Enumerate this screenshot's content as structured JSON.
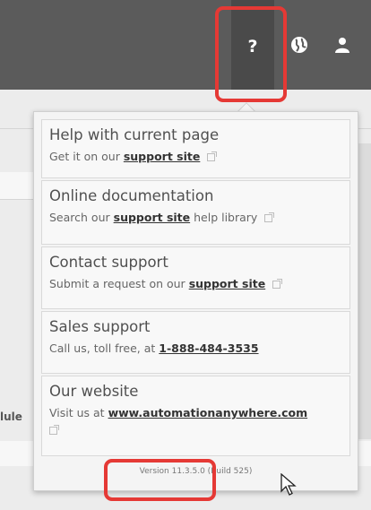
{
  "topbar": {
    "help_label": "?",
    "icons": {
      "globe": "globe-icon",
      "user": "user-icon"
    }
  },
  "background": {
    "left_text": "lule"
  },
  "help_menu": {
    "items": [
      {
        "title": "Help with current page",
        "sub_prefix": "Get it on our",
        "link": "support site",
        "sub_suffix": ""
      },
      {
        "title": "Online documentation",
        "sub_prefix": "Search our",
        "link": "support site",
        "sub_suffix": "help library"
      },
      {
        "title": "Contact support",
        "sub_prefix": "Submit a request on our",
        "link": "support site",
        "sub_suffix": ""
      },
      {
        "title": "Sales support",
        "sub_prefix": "Call us, toll free, at",
        "link": "1-888-484-3535",
        "sub_suffix": ""
      },
      {
        "title": "Our website",
        "sub_prefix": "Visit us at",
        "link": "www.automationanywhere.com",
        "sub_suffix": ""
      }
    ],
    "version": "Version 11.3.5.0 (Build 525)"
  },
  "colors": {
    "topbar": "#5b5b5b",
    "highlight": "#e53935",
    "menu_bg": "#f4f4f4"
  }
}
